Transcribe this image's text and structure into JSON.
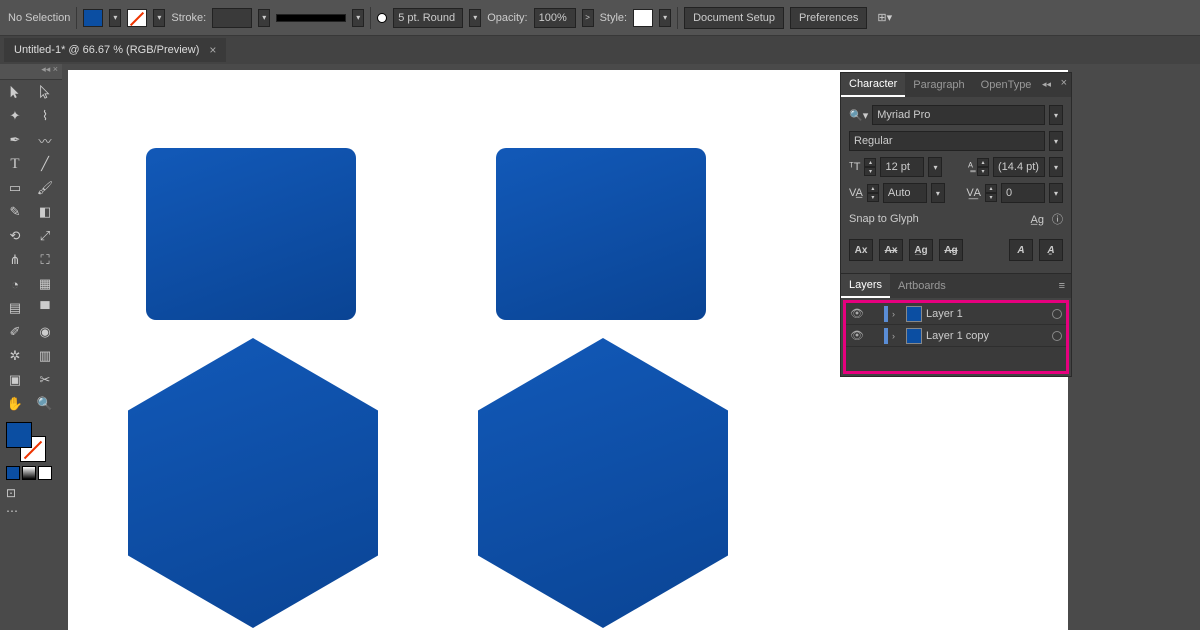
{
  "controlbar": {
    "selection_label": "No Selection",
    "stroke_label": "Stroke:",
    "stroke_weight": "5 pt. Round",
    "opacity_label": "Opacity:",
    "opacity_value": "100%",
    "style_label": "Style:",
    "doc_setup": "Document Setup",
    "preferences": "Preferences"
  },
  "tab": {
    "title": "Untitled-1* @ 66.67 % (RGB/Preview)"
  },
  "character": {
    "tab_character": "Character",
    "tab_paragraph": "Paragraph",
    "tab_opentype": "OpenType",
    "font_family": "Myriad Pro",
    "font_style": "Regular",
    "font_size": "12 pt",
    "leading": "(14.4 pt)",
    "kerning": "Auto",
    "tracking": "0",
    "snap_label": "Snap to Glyph"
  },
  "layers": {
    "tab_layers": "Layers",
    "tab_artboards": "Artboards",
    "items": [
      {
        "name": "Layer 1"
      },
      {
        "name": "Layer 1 copy"
      }
    ]
  }
}
